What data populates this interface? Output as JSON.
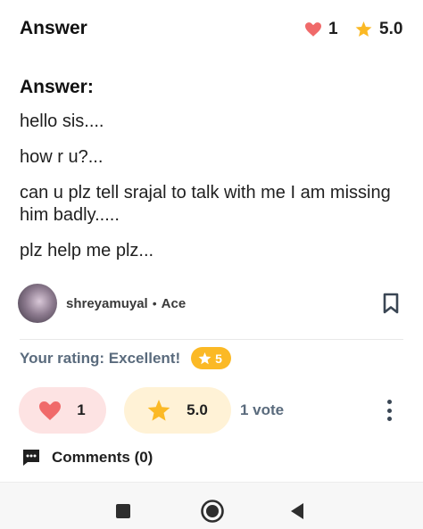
{
  "header": {
    "title": "Answer",
    "likes": "1",
    "rating": "5.0"
  },
  "answer": {
    "label": "Answer:",
    "lines": [
      "hello sis....",
      "how r u?...",
      "can u plz tell srajal to talk with me I am missing him badly.....",
      "plz help me plz..."
    ]
  },
  "author": {
    "name": "shreyamuyal",
    "separator": "•",
    "rank": "Ace"
  },
  "your_rating": {
    "label": "Your rating: Excellent!",
    "value": "5"
  },
  "actions": {
    "likes": "1",
    "rating": "5.0",
    "votes": "1 vote"
  },
  "comments": {
    "label": "Comments (0)"
  },
  "colors": {
    "heart": "#f06a6a",
    "star": "#fbb925",
    "muted": "#5a6b7d"
  },
  "icons": [
    "heart-icon",
    "star-icon",
    "bookmark-icon",
    "comment-icon",
    "more-vertical-icon",
    "nav-recents-icon",
    "nav-home-icon",
    "nav-back-icon"
  ]
}
